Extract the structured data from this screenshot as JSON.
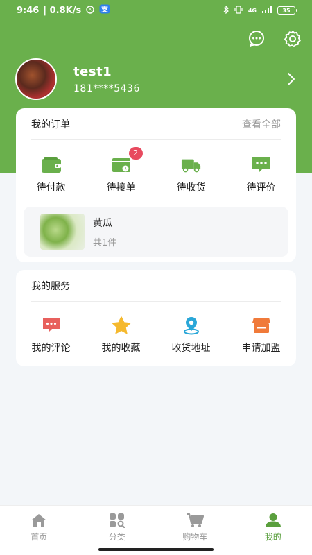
{
  "status_bar": {
    "time": "9:46",
    "network_speed": "| 0.8K/s",
    "signal_label": "4G",
    "battery": "35"
  },
  "colors": {
    "brand_green": "#6ab04c",
    "badge_red": "#e84a5f",
    "active_tab": "#5a9f3d"
  },
  "profile": {
    "username": "test1",
    "phone": "181****5436"
  },
  "orders": {
    "title": "我的订单",
    "view_all": "查看全部",
    "items": [
      {
        "label": "待付款",
        "icon": "wallet-icon"
      },
      {
        "label": "待接单",
        "icon": "pending-order-icon",
        "badge": "2"
      },
      {
        "label": "待收货",
        "icon": "truck-icon"
      },
      {
        "label": "待评价",
        "icon": "review-icon"
      }
    ],
    "product": {
      "name": "黄瓜",
      "count": "共1件"
    }
  },
  "services": {
    "title": "我的服务",
    "items": [
      {
        "label": "我的评论",
        "icon": "comment-icon"
      },
      {
        "label": "我的收藏",
        "icon": "star-icon"
      },
      {
        "label": "收货地址",
        "icon": "location-icon"
      },
      {
        "label": "申请加盟",
        "icon": "store-icon"
      }
    ]
  },
  "tabbar": {
    "items": [
      {
        "label": "首页",
        "icon": "home-icon"
      },
      {
        "label": "分类",
        "icon": "category-icon"
      },
      {
        "label": "购物车",
        "icon": "cart-icon"
      },
      {
        "label": "我的",
        "icon": "user-icon",
        "active": true
      }
    ]
  }
}
